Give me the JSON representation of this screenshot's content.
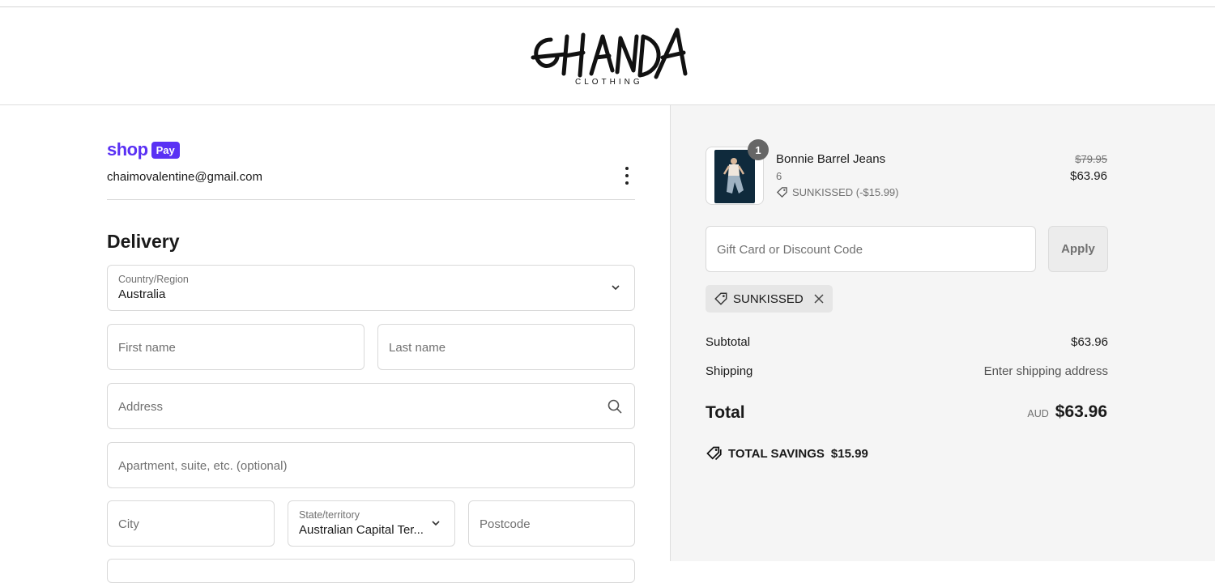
{
  "brand": {
    "logo_main": "CHANDA",
    "logo_sub": "CLOTHING"
  },
  "account": {
    "shoppay_word": "shop",
    "shoppay_badge": "Pay",
    "email": "chaimovalentine@gmail.com"
  },
  "delivery": {
    "title": "Delivery",
    "country": {
      "label": "Country/Region",
      "value": "Australia"
    },
    "first_name": {
      "placeholder": "First name"
    },
    "last_name": {
      "placeholder": "Last name"
    },
    "address": {
      "placeholder": "Address"
    },
    "apartment": {
      "placeholder": "Apartment, suite, etc. (optional)"
    },
    "city": {
      "placeholder": "City"
    },
    "state": {
      "label": "State/territory",
      "value": "Australian Capital Ter..."
    },
    "postcode": {
      "placeholder": "Postcode"
    }
  },
  "summary": {
    "item": {
      "name": "Bonnie Barrel Jeans",
      "variant": "6",
      "quantity": "1",
      "discount": "SUNKISSED (-$15.99)",
      "price_original": "$79.95",
      "price_now": "$63.96"
    },
    "discount_input": {
      "placeholder": "Gift Card or Discount Code"
    },
    "apply_label": "Apply",
    "applied_code": "SUNKISSED",
    "subtotal_label": "Subtotal",
    "subtotal_value": "$63.96",
    "shipping_label": "Shipping",
    "shipping_value": "Enter shipping address",
    "total_label": "Total",
    "total_currency": "AUD",
    "total_value": "$63.96",
    "savings_label": "TOTAL SAVINGS",
    "savings_value": "$15.99"
  }
}
